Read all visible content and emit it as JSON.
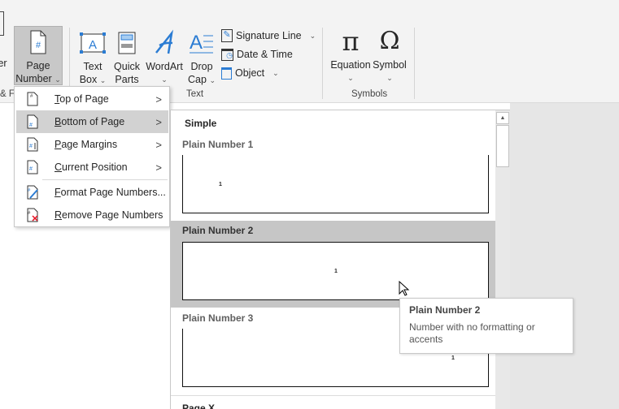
{
  "ribbon": {
    "partial_left_label": "ter",
    "partial_group_label": "& F",
    "page_number": {
      "line1": "Page",
      "line2": "Number"
    },
    "text_box": {
      "line1": "Text",
      "line2": "Box"
    },
    "quick_parts": {
      "line1": "Quick",
      "line2": "Parts"
    },
    "wordart": {
      "line1": "WordArt"
    },
    "drop_cap": {
      "line1": "Drop",
      "line2": "Cap"
    },
    "signature_line": "Signature Line",
    "date_time": "Date & Time",
    "object": "Object",
    "equation": "Equation",
    "symbol": "Symbol",
    "text_group": "Text",
    "symbols_group": "Symbols"
  },
  "menu": {
    "items": [
      {
        "mn": "T",
        "rest": "op of Page",
        "submenu": true
      },
      {
        "mn": "B",
        "rest": "ottom of Page",
        "submenu": true
      },
      {
        "mn": "P",
        "rest": "age Margins",
        "submenu": true
      },
      {
        "mn": "C",
        "rest": "urrent Position",
        "submenu": true
      },
      {
        "mn": "F",
        "rest": "ormat Page Numbers...",
        "submenu": false
      },
      {
        "mn": "R",
        "rest": "emove Page Numbers",
        "submenu": false
      }
    ]
  },
  "gallery": {
    "section": "Simple",
    "items": [
      {
        "name": "Plain Number 1",
        "number": "1"
      },
      {
        "name": "Plain Number 2",
        "number": "1"
      },
      {
        "name": "Plain Number 3",
        "number": "1"
      }
    ],
    "next_section": "Page X"
  },
  "tooltip": {
    "title": "Plain Number 2",
    "body": "Number with no formatting or accents"
  },
  "colors": {
    "accent": "#2b7cd3",
    "highlight": "#c6c6c6",
    "ribbon_bg": "#f3f3f3"
  }
}
